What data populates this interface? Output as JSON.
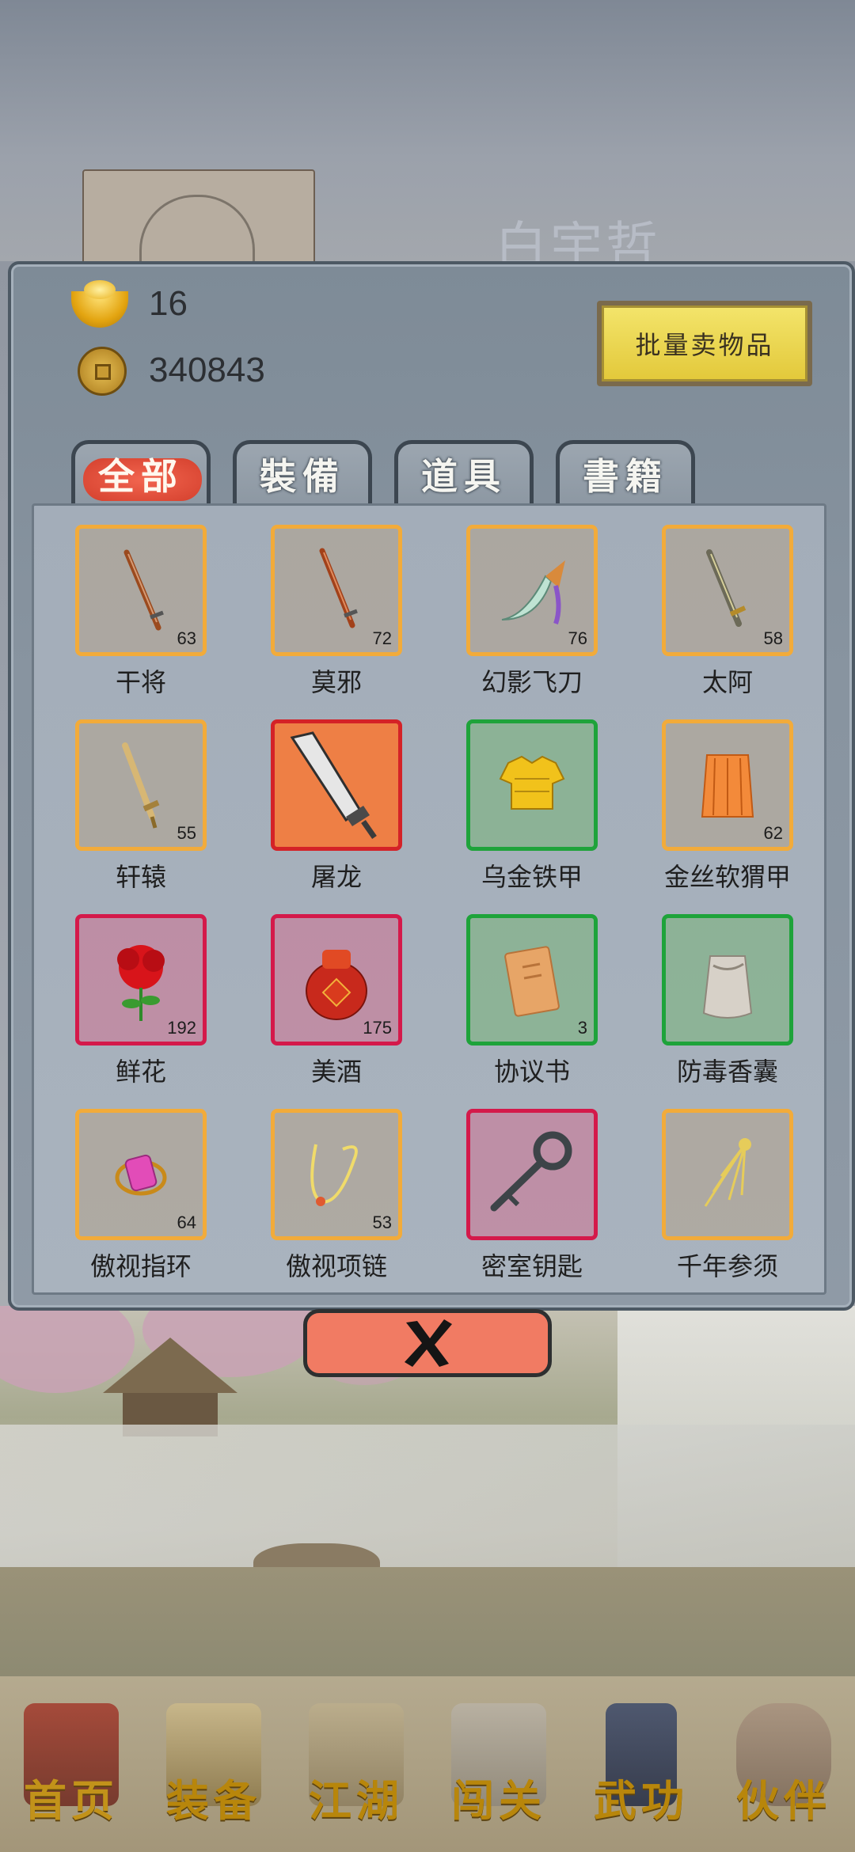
{
  "background": {
    "character_name": "白宇哲"
  },
  "panel": {
    "gold_ingot": "16",
    "copper_coins": "340843",
    "sell_button_label": "批量卖物品",
    "tabs": [
      {
        "label": "全部",
        "active": true
      },
      {
        "label": "裝備",
        "active": false
      },
      {
        "label": "道具",
        "active": false
      },
      {
        "label": "書籍",
        "active": false
      }
    ],
    "items": [
      {
        "name": "干将",
        "count": "63",
        "rarity": "orange",
        "icon": "sword-icon"
      },
      {
        "name": "莫邪",
        "count": "72",
        "rarity": "orange",
        "icon": "sword-icon"
      },
      {
        "name": "幻影飞刀",
        "count": "76",
        "rarity": "orange",
        "icon": "flying-dagger-icon"
      },
      {
        "name": "太阿",
        "count": "58",
        "rarity": "orange",
        "icon": "sword-icon"
      },
      {
        "name": "轩辕",
        "count": "55",
        "rarity": "orange",
        "icon": "golden-sword-icon"
      },
      {
        "name": "屠龙",
        "count": "",
        "rarity": "red-orange",
        "icon": "broadsword-icon"
      },
      {
        "name": "乌金铁甲",
        "count": "",
        "rarity": "green",
        "icon": "armor-icon"
      },
      {
        "name": "金丝软猬甲",
        "count": "62",
        "rarity": "orange",
        "icon": "soft-armor-icon"
      },
      {
        "name": "鲜花",
        "count": "192",
        "rarity": "red",
        "icon": "rose-icon"
      },
      {
        "name": "美酒",
        "count": "175",
        "rarity": "red",
        "icon": "wine-jar-icon"
      },
      {
        "name": "协议书",
        "count": "3",
        "rarity": "green",
        "icon": "document-icon"
      },
      {
        "name": "防毒香囊",
        "count": "",
        "rarity": "green",
        "icon": "sachet-icon"
      },
      {
        "name": "傲视指环",
        "count": "64",
        "rarity": "orange",
        "icon": "ring-icon"
      },
      {
        "name": "傲视项链",
        "count": "53",
        "rarity": "orange",
        "icon": "necklace-icon"
      },
      {
        "name": "密室钥匙",
        "count": "",
        "rarity": "red",
        "icon": "key-icon"
      },
      {
        "name": "千年参须",
        "count": "",
        "rarity": "orange",
        "icon": "ginseng-icon"
      }
    ]
  },
  "bottom_nav": [
    {
      "label": "首页",
      "active": true
    },
    {
      "label": "装备",
      "active": false
    },
    {
      "label": "江湖",
      "active": false
    },
    {
      "label": "闯关",
      "active": false
    },
    {
      "label": "武功",
      "active": false
    },
    {
      "label": "伙伴",
      "active": false
    }
  ],
  "colors": {
    "rarity_orange": "#f2ab3a",
    "rarity_green": "#1ea33a",
    "rarity_red": "#d4194a",
    "tab_active": "#e54a35",
    "sell_button": "#ecd64f",
    "close_button": "#f17b63"
  }
}
